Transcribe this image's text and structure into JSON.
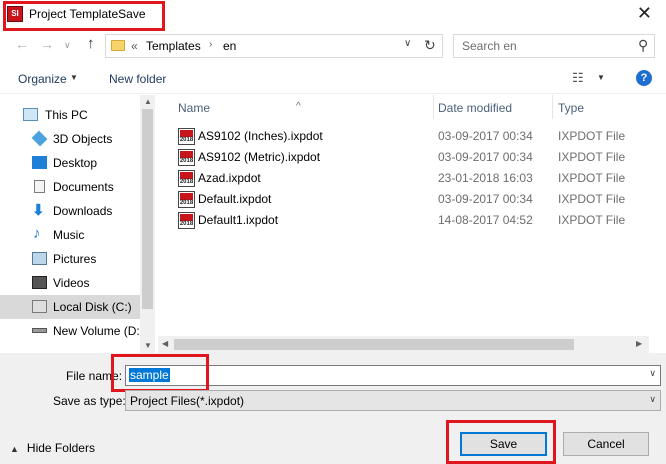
{
  "window": {
    "title": "Project TemplateSave",
    "app_icon_text": "SI",
    "close_glyph": "✕"
  },
  "nav_buttons": {
    "back": "←",
    "forward": "→",
    "up": "↑"
  },
  "address": {
    "chevrons": "«",
    "crumbs": [
      "Templates",
      "en"
    ],
    "separator": "›",
    "dropdown": "∨",
    "refresh": "↻"
  },
  "search": {
    "placeholder": "Search en",
    "icon": "search-icon"
  },
  "toolbar": {
    "organize": "Organize",
    "new_folder": "New folder",
    "view_glyph": "☷",
    "help": "?"
  },
  "sidebar": {
    "items": [
      {
        "label": "This PC",
        "icon": "computer-icon"
      },
      {
        "label": "3D Objects",
        "icon": "cube-icon"
      },
      {
        "label": "Desktop",
        "icon": "desktop-icon"
      },
      {
        "label": "Documents",
        "icon": "document-icon"
      },
      {
        "label": "Downloads",
        "icon": "download-icon"
      },
      {
        "label": "Music",
        "icon": "music-icon"
      },
      {
        "label": "Pictures",
        "icon": "picture-icon"
      },
      {
        "label": "Videos",
        "icon": "video-icon"
      },
      {
        "label": "Local Disk (C:)",
        "icon": "drive-icon",
        "selected": true
      },
      {
        "label": "New Volume (D:",
        "icon": "drive-icon"
      }
    ]
  },
  "filelist": {
    "columns": {
      "name": "Name",
      "date": "Date modified",
      "type": "Type"
    },
    "files": [
      {
        "name": "AS9102 (Inches).ixpdot",
        "date": "03-09-2017 00:34",
        "type": "IXPDOT File"
      },
      {
        "name": "AS9102 (Metric).ixpdot",
        "date": "03-09-2017 00:34",
        "type": "IXPDOT File"
      },
      {
        "name": "Azad.ixpdot",
        "date": "23-01-2018 16:03",
        "type": "IXPDOT File"
      },
      {
        "name": "Default.ixpdot",
        "date": "03-09-2017 00:34",
        "type": "IXPDOT File"
      },
      {
        "name": "Default1.ixpdot",
        "date": "14-08-2017 04:52",
        "type": "IXPDOT File"
      }
    ]
  },
  "form": {
    "filename_label": "File name:",
    "filename_value": "sample",
    "type_label": "Save as type:",
    "type_value": "Project Files(*.ixpdot)"
  },
  "footer": {
    "hide_folders": "Hide Folders",
    "save": "Save",
    "cancel": "Cancel"
  },
  "colors": {
    "highlight": "#e0161f",
    "accent": "#0078d7"
  }
}
